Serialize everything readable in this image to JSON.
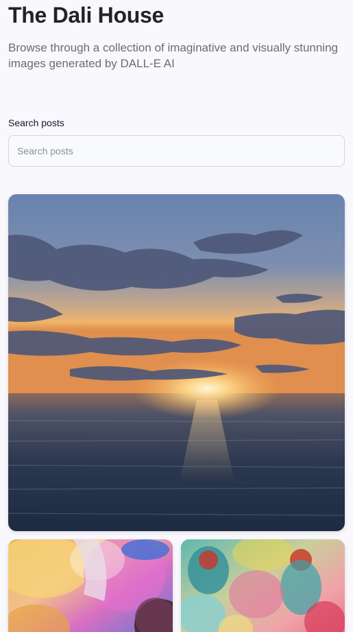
{
  "header": {
    "title": "The Dali House",
    "subtitle": "Browse through a collection of imaginative and visually stunning images generated by DALL-E AI"
  },
  "search": {
    "label": "Search posts",
    "placeholder": "Search posts",
    "value": ""
  },
  "posts": [
    {
      "image": "ocean-sunset-image"
    },
    {
      "image": "color-powder-festival-image"
    },
    {
      "image": "holi-crowd-image"
    }
  ]
}
